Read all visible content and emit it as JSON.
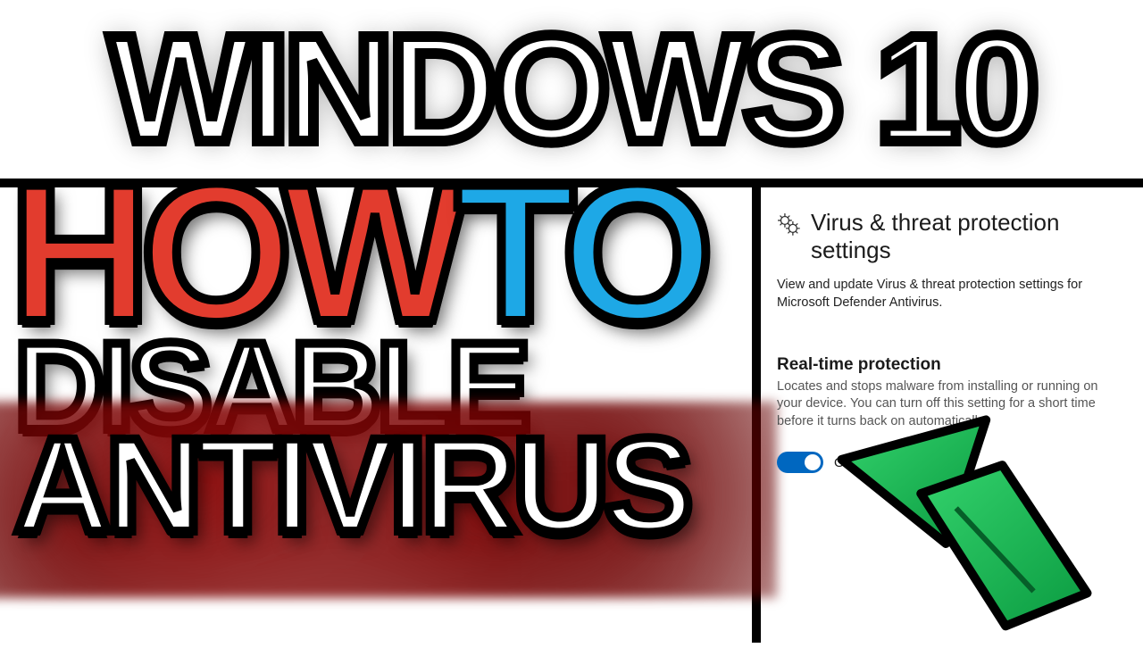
{
  "thumbnail": {
    "top_title": "WINDOWS 10",
    "line1_a": "HOW",
    "line1_b": "TO",
    "line2": "DISABLE",
    "line3": "ANTIVIRUS"
  },
  "settings": {
    "title": "Virus & threat protection settings",
    "description": "View and update Virus & threat protection settings for Microsoft Defender Antivirus.",
    "realtime": {
      "title": "Real-time protection",
      "description": "Locates and stops malware from installing or running on your device. You can turn off this setting for a short time before it turns back on automatically.",
      "state_label": "On"
    }
  },
  "colors": {
    "accent_blue": "#0067c0",
    "red": "#e23c2e",
    "cyan": "#1ea8e6",
    "arrow_green": "#1fbf56",
    "arrow_dark": "#0a8a3a"
  }
}
